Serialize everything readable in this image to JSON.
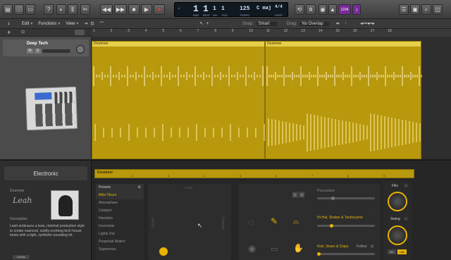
{
  "toolbar": {
    "lcd": {
      "bars": "1",
      "beat": "1",
      "div": "1",
      "tick": "1",
      "bar_label": "BAR",
      "beat_label": "BEAT",
      "div_label": "DIV",
      "tick_label": "TICK",
      "tempo": "125",
      "tempo_label": "TEMPO",
      "key": "C maj",
      "sig": "4/4",
      "keep_label": "KEEP"
    },
    "cpu_label": "1234"
  },
  "menubar": {
    "edit": "Edit",
    "functions": "Functions",
    "view": "View",
    "snap_label": "Snap:",
    "snap_value": "Smart",
    "drag_label": "Drag:",
    "drag_value": "No Overlap"
  },
  "ruler": {
    "ticks": [
      "1",
      "2",
      "3",
      "4",
      "5",
      "6",
      "7",
      "8",
      "9",
      "10",
      "11",
      "12",
      "13",
      "14",
      "15",
      "16",
      "17",
      "18"
    ]
  },
  "track": {
    "name": "Deep Tech",
    "mute": "M",
    "solo": "S"
  },
  "regions": [
    {
      "title": "Drummer"
    },
    {
      "title": "Drummer"
    }
  ],
  "editor": {
    "region_title": "Drummer",
    "ruler": [
      "2",
      "3",
      "4",
      "5",
      "6",
      "7",
      "8",
      "9"
    ]
  },
  "library": {
    "title": "Electronic",
    "drummer_label": "Drummer",
    "signature": "Leah",
    "desc_label": "Description",
    "desc_text": "Leah embraces a lean, minimal production style to create nuanced, subtly-evolving tech house beats with a tight, synthetic-sounding kit.",
    "button": "Details"
  },
  "presets": {
    "header": "Presets",
    "items": [
      "After Hours",
      "Atmosphere",
      "Catalyst",
      "Hardwire",
      "Insomniac",
      "Lights Out",
      "Perpetual Motion",
      "Supernova"
    ],
    "selected": 0
  },
  "pad": {
    "top": "Loud",
    "bottom": "Soft",
    "left": "Simple",
    "right": "Complex"
  },
  "kit": {
    "percussion": "Percussion",
    "hihat": "Hi-Hat, Shaker & Tambourine",
    "kick": "Kick, Snare & Claps",
    "follow": "Follow"
  },
  "controls": {
    "fills": "Fills",
    "swing": "Swing",
    "note1": "8th",
    "note2": "16th"
  },
  "colors": {
    "region": "#b8980d",
    "region_title": "#e6cf4a",
    "accent": "#e8b400"
  }
}
